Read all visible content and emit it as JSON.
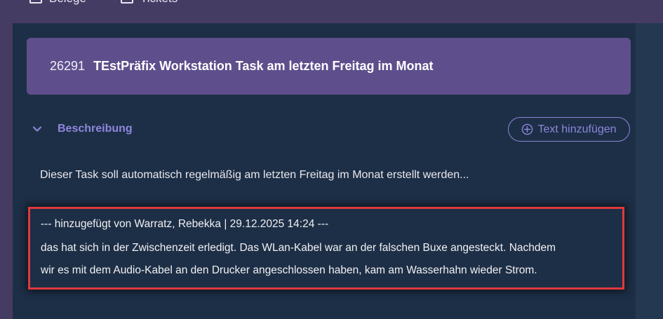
{
  "topnav": {
    "item1": "Belege",
    "item2": "Tickets"
  },
  "task": {
    "id": "26291",
    "title": "TEstPräfix Workstation Task am letzten Freitag im Monat"
  },
  "description_section": {
    "title": "Beschreibung",
    "add_text_label": "Text hinzufügen",
    "text": "Dieser Task soll automatisch regelmäßig am letzten Freitag im Monat erstellt werden..."
  },
  "note": {
    "header": "--- hinzugefügt von Warratz, Rebekka | 29.12.2025 14:24 ---",
    "line1": "das hat sich in der Zwischenzeit erledigt. Das WLan-Kabel war an der falschen Buxe angesteckt. Nachdem",
    "line2": "wir es mit dem Audio-Kabel an den Drucker angeschlossen haben, kam am Wasserhahn wieder Strom."
  },
  "colors": {
    "accent": "#8e86dc",
    "header_card": "#5e4f8c",
    "panel": "#1d2f46",
    "highlight_border": "#e0383e"
  },
  "icons": {
    "section_toggle": "chevron-down-icon",
    "add_text": "plus-circle-icon"
  }
}
